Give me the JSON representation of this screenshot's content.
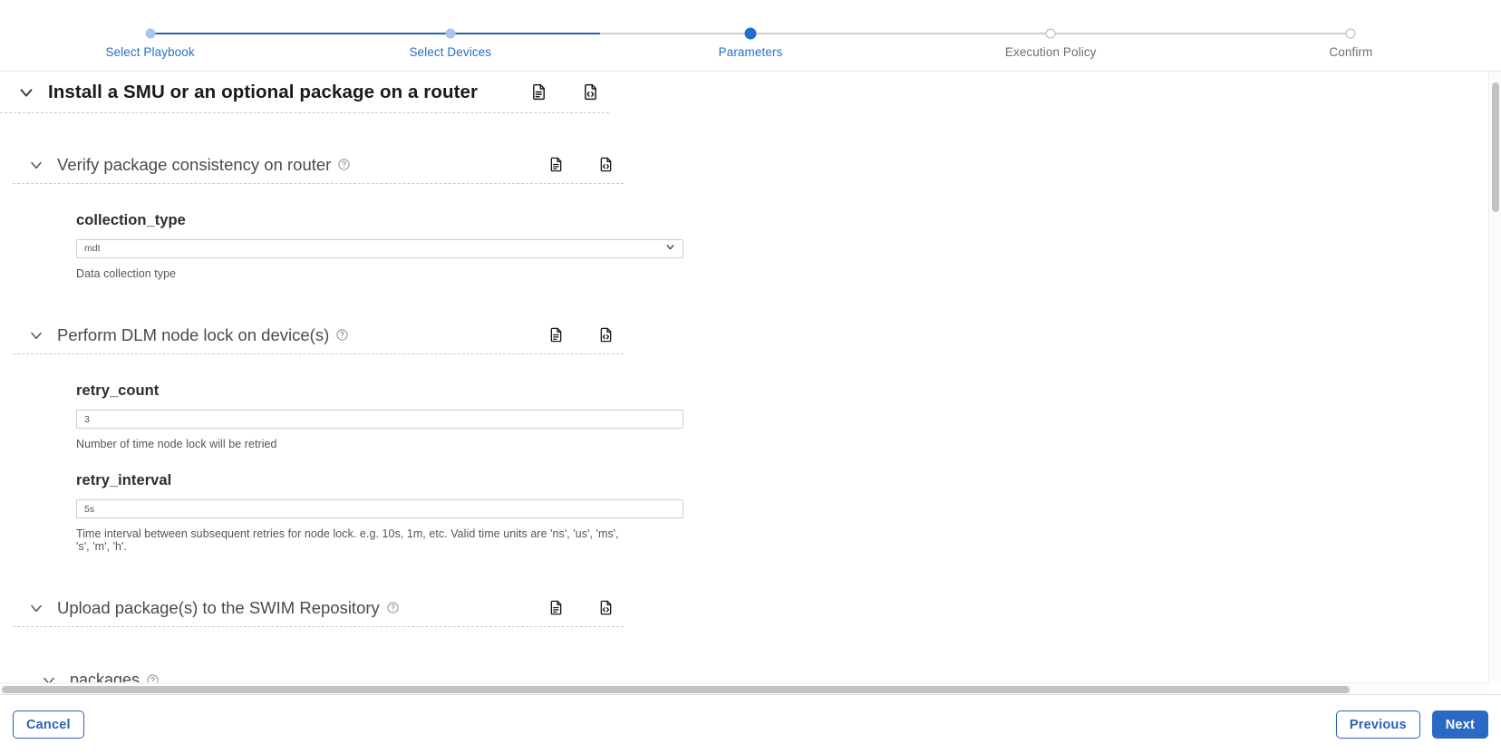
{
  "stepper": {
    "steps": [
      {
        "label": "Select Playbook",
        "state": "done"
      },
      {
        "label": "Select Devices",
        "state": "done"
      },
      {
        "label": "Parameters",
        "state": "current"
      },
      {
        "label": "Execution Policy",
        "state": "todo"
      },
      {
        "label": "Confirm",
        "state": "todo"
      }
    ]
  },
  "colors": {
    "accent": "#2a6ac4",
    "step_done": "#a7c4ea",
    "step_current": "#1f6fd0",
    "step_todo_border": "#b6b6b6",
    "link_blue": "#2a6fc4",
    "helper_gray": "#555555"
  },
  "playbook": {
    "title": "Install a SMU or an optional package on a router",
    "doc_icon": "document-icon",
    "code_icon": "code-document-icon"
  },
  "sections": [
    {
      "title": "Verify package consistency on router",
      "has_help": true,
      "fields": [
        {
          "type": "select",
          "label": "collection_type",
          "value": "mdt",
          "options": [
            "mdt"
          ],
          "helper": "Data collection type"
        }
      ]
    },
    {
      "title": "Perform DLM node lock on device(s)",
      "has_help": true,
      "fields": [
        {
          "type": "text",
          "label": "retry_count",
          "value": "3",
          "helper": "Number of time node lock will be retried"
        },
        {
          "type": "text",
          "label": "retry_interval",
          "value": "5s",
          "helper": "Time interval between subsequent retries for node lock. e.g. 10s, 1m, etc. Valid time units are 'ns', 'us', 'ms', 's', 'm', 'h'."
        }
      ]
    },
    {
      "title": "Upload package(s) to the SWIM Repository",
      "has_help": true,
      "subsection": {
        "title": "packages",
        "has_help": true
      }
    }
  ],
  "footer": {
    "cancel_label": "Cancel",
    "previous_label": "Previous",
    "next_label": "Next"
  }
}
